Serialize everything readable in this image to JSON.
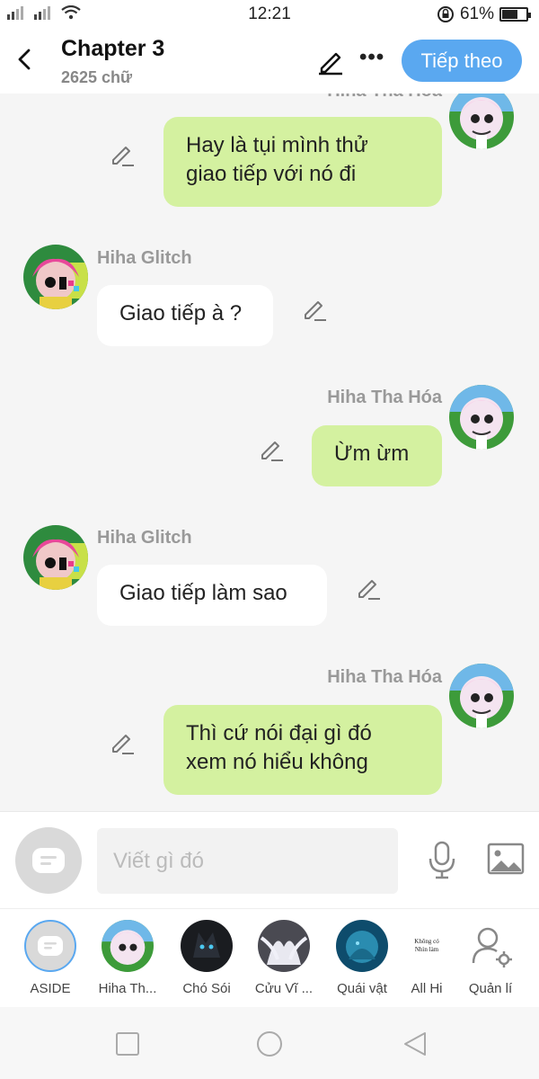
{
  "status_bar": {
    "time": "12:21",
    "battery_percent": "61%",
    "battery_level": 0.61
  },
  "header": {
    "title": "Chapter 3",
    "subtitle": "2625 chữ",
    "next_label": "Tiếp theo"
  },
  "messages": [
    {
      "side": "right",
      "name": "Hiha Tha Hóa",
      "lines": [
        "Hay là tụi mình thử",
        "giao tiếp với nó đi"
      ]
    },
    {
      "side": "left",
      "name": "Hiha Glitch",
      "lines": [
        "Giao tiếp à ?"
      ]
    },
    {
      "side": "right",
      "name": "Hiha Tha Hóa",
      "lines": [
        "Ừm ừm"
      ]
    },
    {
      "side": "left",
      "name": "Hiha Glitch",
      "lines": [
        "Giao tiếp làm sao"
      ]
    },
    {
      "side": "right",
      "name": "Hiha Tha Hóa",
      "lines": [
        "Thì cứ nói đại gì đó",
        "xem nó hiểu không"
      ]
    }
  ],
  "input": {
    "placeholder": "Viết gì đó"
  },
  "characters": [
    {
      "label": "ASIDE"
    },
    {
      "label": "Hiha Th..."
    },
    {
      "label": "Chó Sói"
    },
    {
      "label": "Cửu Vĩ ..."
    },
    {
      "label": "Quái vật"
    },
    {
      "label": "All Hi",
      "pic_text": "Không có Nhìn làm"
    },
    {
      "label": "Quản lí"
    }
  ],
  "colors": {
    "accent": "#5aa8f0",
    "bubble_right": "#d4f1a0",
    "bubble_left": "#ffffff"
  }
}
